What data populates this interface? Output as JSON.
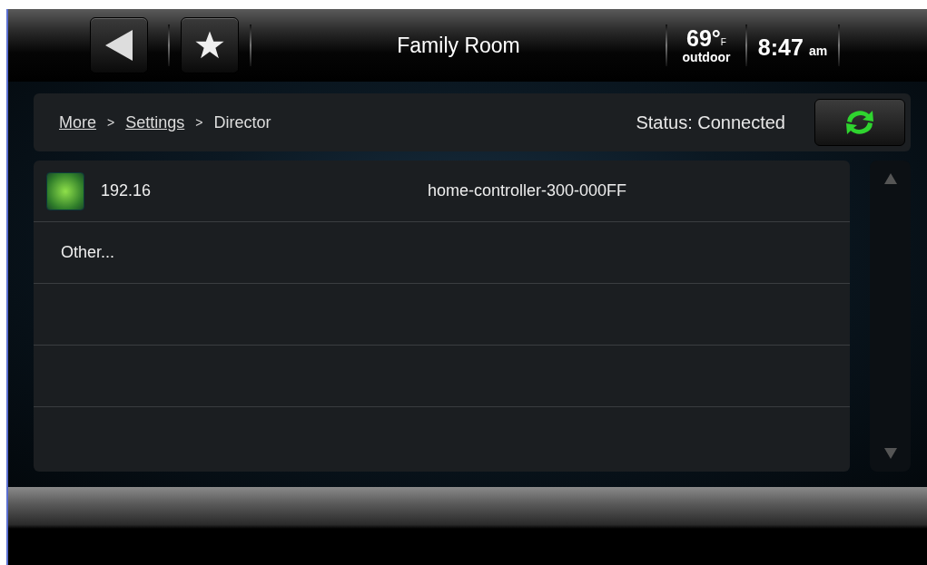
{
  "header": {
    "title": "Family Room",
    "temperature": "69°",
    "temperature_unit": "F",
    "temperature_label": "outdoor",
    "time": "8:47",
    "time_period": "am"
  },
  "breadcrumb": [
    {
      "label": "More",
      "link": true
    },
    {
      "label": ">",
      "link": false
    },
    {
      "label": "Settings",
      "link": true
    },
    {
      "label": ">",
      "link": false
    },
    {
      "label": "Director",
      "link": false
    }
  ],
  "status": "Status: Connected",
  "directors": [
    {
      "kind": "device",
      "address": "192.16",
      "name": "home-controller-300-000FF"
    },
    {
      "kind": "other",
      "label": "Other..."
    }
  ]
}
